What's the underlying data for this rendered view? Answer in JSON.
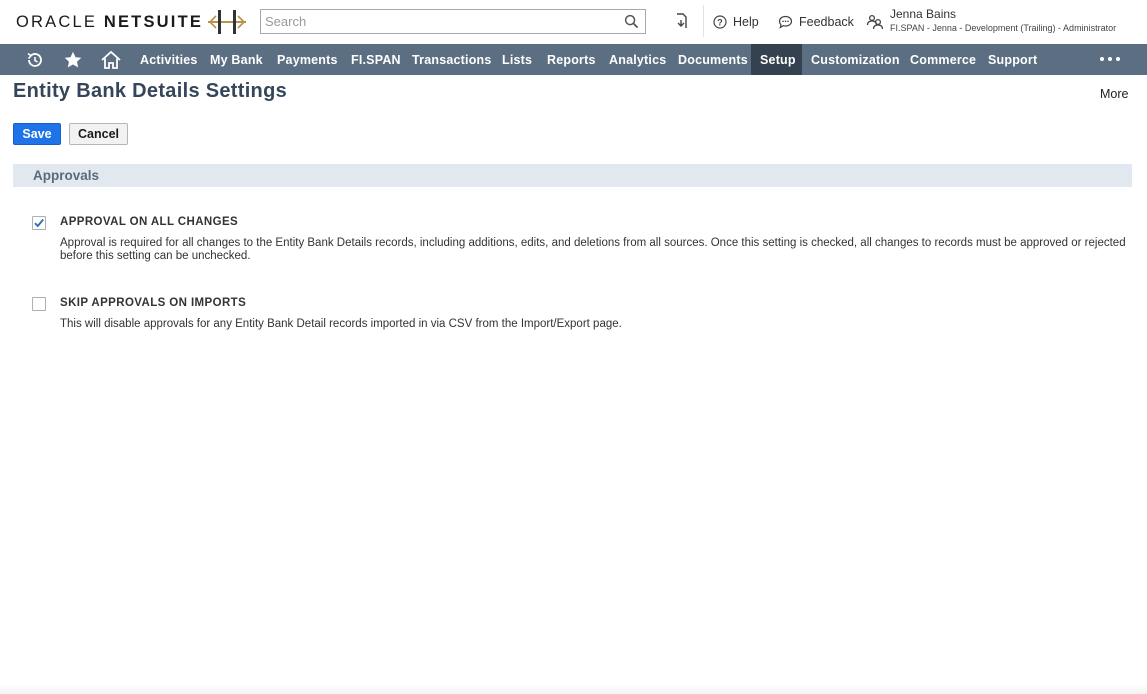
{
  "header": {
    "logo_left": "ORACLE",
    "logo_right": "NETSUITE",
    "search": {
      "placeholder": "Search",
      "value": ""
    },
    "help_label": "Help",
    "feedback_label": "Feedback",
    "user": {
      "name": "Jenna Bains",
      "role": "FI.SPAN - Jenna - Development (Trailing) - Administrator"
    }
  },
  "nav": {
    "items": [
      {
        "label": "Activities"
      },
      {
        "label": "My Bank"
      },
      {
        "label": "Payments"
      },
      {
        "label": "FI.SPAN"
      },
      {
        "label": "Transactions"
      },
      {
        "label": "Lists"
      },
      {
        "label": "Reports"
      },
      {
        "label": "Analytics"
      },
      {
        "label": "Documents"
      },
      {
        "label": "Setup"
      },
      {
        "label": "Customization"
      },
      {
        "label": "Commerce"
      },
      {
        "label": "Support"
      }
    ],
    "active": "Setup"
  },
  "page": {
    "title": "Entity Bank Details Settings",
    "more_label": "More",
    "save_label": "Save",
    "cancel_label": "Cancel",
    "section_title": "Approvals",
    "settings": [
      {
        "label": "APPROVAL ON ALL CHANGES",
        "description": "Approval is required for all changes to the Entity Bank Details records, including additions, edits, and deletions from all sources. Once this setting is checked, all changes to records must be approved or rejected before this setting can be unchecked.",
        "checked": true
      },
      {
        "label": "SKIP APPROVALS ON IMPORTS",
        "description": "This will disable approvals for any Entity Bank Detail records imported in via CSV from the Import/Export page.",
        "checked": false
      }
    ]
  },
  "colors": {
    "nav_bg": "#5b6e82",
    "nav_active_bg": "#34414f",
    "save_button": "#1f73e8",
    "title_text": "#36465a",
    "section_bg": "#e2e8ef",
    "brand_gold": "#b9934a"
  }
}
